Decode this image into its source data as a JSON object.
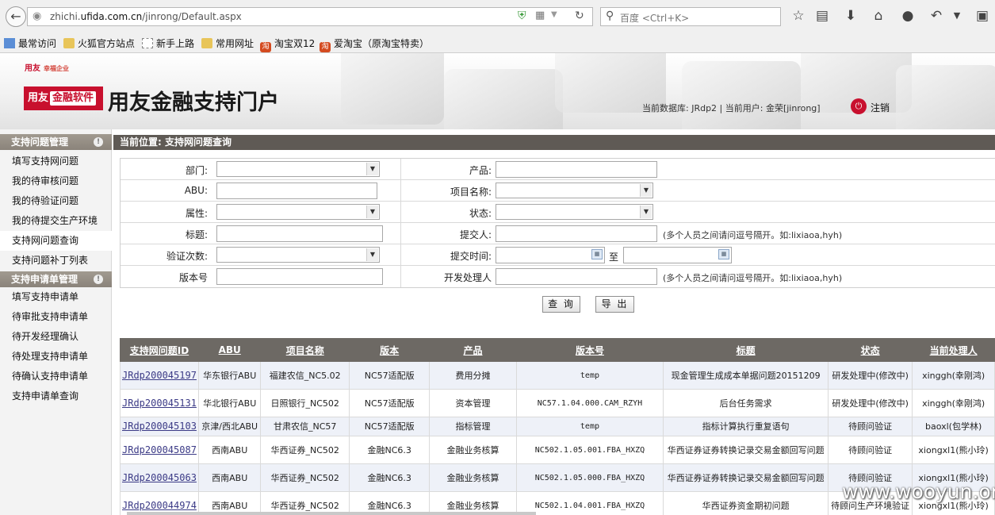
{
  "browser": {
    "url_prefix": "zhichi.",
    "url_domain": "ufida.com.cn",
    "url_path": "/jinrong/Default.aspx",
    "search_placeholder": "百度 <Ctrl+K>",
    "bookmarks": [
      "最常访问",
      "火狐官方站点",
      "新手上路",
      "常用网址",
      "淘宝双12",
      "爱淘宝（原淘宝特卖）"
    ]
  },
  "header": {
    "small_logo": "用友",
    "small_logo_tag": "幸福企业",
    "logo_text": "用友",
    "logo_text_2": "金融软件",
    "site_title": "用友金融支持门户",
    "user_info": "当前数据库: JRdp2 | 当前用户: 金荣[jinrong]",
    "logout": "注销"
  },
  "sidebar": {
    "section1_title": "支持问题管理",
    "section1_items": [
      "填写支持网问题",
      "我的待审核问题",
      "我的待验证问题",
      "我的待提交生产环境",
      "支持网问题查询",
      "支持问题补丁列表"
    ],
    "section2_title": "支持申请单管理",
    "section2_items": [
      "填写支持申请单",
      "待审批支持申请单",
      "待开发经理确认",
      "待处理支持申请单",
      "待确认支持申请单",
      "支持申请单查询"
    ]
  },
  "breadcrumb": "当前位置: 支持网问题查询",
  "form": {
    "dept_label": "部门:",
    "product_label": "产品:",
    "abu_label": "ABU:",
    "project_label": "项目名称:",
    "attr_label": "属性:",
    "status_label": "状态:",
    "title_label": "标题:",
    "submitter_label": "提交人:",
    "submitter_hint": "(多个人员之间请问逗号隔开。如:lixiaoa,hyh)",
    "verify_label": "验证次数:",
    "submit_time_label": "提交时间:",
    "to_label": "至",
    "version_label": "版本号",
    "dev_label": "开发处理人",
    "dev_hint": "(多个人员之间请问逗号隔开。如:lixiaoa,hyh)",
    "query_button": "查 询",
    "export_button": "导 出"
  },
  "table": {
    "headers": [
      "支持网问题ID",
      "ABU",
      "项目名称",
      "版本",
      "产品",
      "版本号",
      "标题",
      "状态",
      "当前处理人"
    ],
    "rows": [
      [
        "JRdp200045197",
        "华东银行ABU",
        "福建农信_NC5.02",
        "NC57适配版",
        "费用分摊",
        "temp",
        "现金管理生成成本单据问题20151209",
        "研发处理中(修改中)",
        "xinggh(幸刚鸿)"
      ],
      [
        "JRdp200045131",
        "华北银行ABU",
        "日照银行_NC502",
        "NC57适配版",
        "资本管理",
        "NC57.1.04.000.CAM_RZYH",
        "后台任务需求",
        "研发处理中(修改中)",
        "xinggh(幸刚鸿)"
      ],
      [
        "JRdp200045103",
        "京津/西北ABU",
        "甘肃农信_NC57",
        "NC57适配版",
        "指标管理",
        "temp",
        "指标计算执行重复语句",
        "待顾问验证",
        "baoxl(包学林)"
      ],
      [
        "JRdp200045087",
        "西南ABU",
        "华西证券_NC502",
        "金融NC6.3",
        "金融业务核算",
        "NC502.1.05.001.FBA_HXZQ",
        "华西证券证券转换记录交易金额回写问题",
        "待顾问验证",
        "xiongxl1(熊小玲)"
      ],
      [
        "JRdp200045063",
        "西南ABU",
        "华西证券_NC502",
        "金融NC6.3",
        "金融业务核算",
        "NC502.1.05.000.FBA_HXZQ",
        "华西证券证券转换记录交易金额回写问题",
        "待顾问验证",
        "xiongxl1(熊小玲)"
      ],
      [
        "JRdp200044974",
        "西南ABU",
        "华西证券_NC502",
        "金融NC6.3",
        "金融业务核算",
        "NC502.1.04.001.FBA_HXZQ",
        "华西证券资金期初问题",
        "待顾问生产环境验证",
        "xiongxl1(熊小玲)"
      ]
    ]
  },
  "watermark": "www.wooyun.org"
}
